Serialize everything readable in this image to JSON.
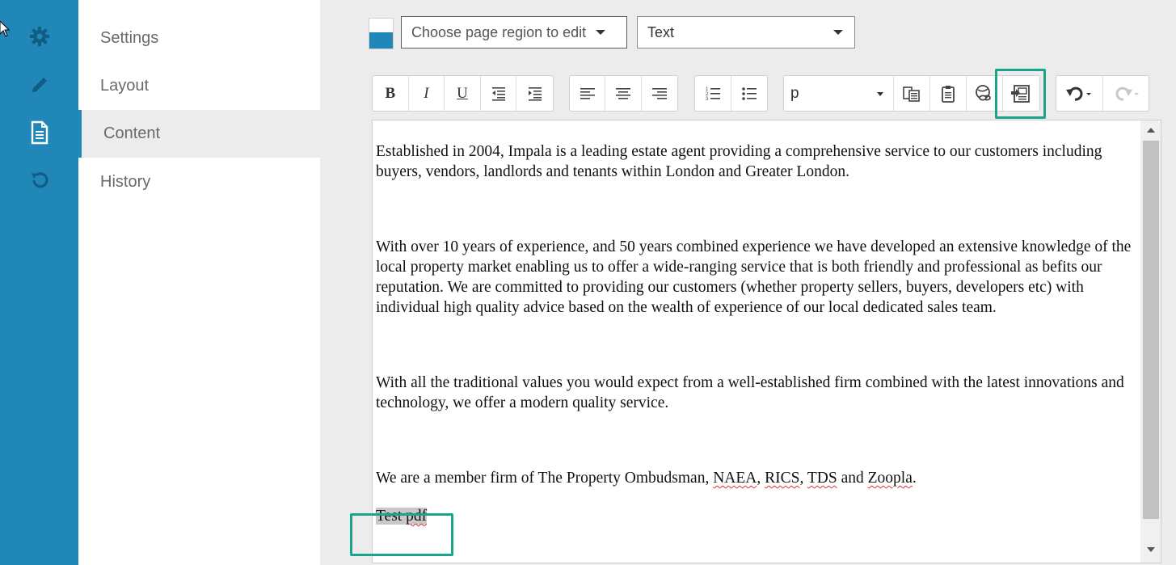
{
  "rail": {
    "icons": [
      "gear-icon",
      "pencil-icon",
      "document-icon",
      "history-icon"
    ],
    "active_index": 2
  },
  "nav": {
    "items": [
      {
        "label": "Settings"
      },
      {
        "label": "Layout"
      },
      {
        "label": "Content"
      },
      {
        "label": "History"
      }
    ],
    "active": "Content"
  },
  "top": {
    "region_select": "Choose page region to edit",
    "type_select": "Text"
  },
  "toolbar": {
    "bold": "B",
    "italic": "I",
    "underline": "U",
    "format_value": "p",
    "highlighted_button": "insert-document-icon"
  },
  "editor": {
    "paragraphs": [
      "Established in 2004, Impala is a leading estate agent providing a comprehensive service to our customers including buyers, vendors, landlords and tenants within London and Greater London.",
      "With over 10 years of experience, and 50 years combined experience we have developed an extensive knowledge of the local property market enabling us to offer a wide-ranging service that is both friendly and professional as befits our reputation. We are committed to providing our customers (whether property sellers, buyers, developers etc) with individual high quality advice based on the wealth of experience of our local dedicated sales team.",
      "With all the traditional values you would expect from a well-established firm combined with the latest innovations and technology, we offer a modern quality service."
    ],
    "member_line": {
      "prefix": "We are a member firm of The Property Ombudsman, ",
      "naea": "NAEA",
      "sep1": ", ",
      "rics": "RICS",
      "sep2": ", ",
      "tds": "TDS",
      "and": " and ",
      "zoopla": "Zoopla",
      "end": "."
    },
    "selected_text_1": "Test ",
    "selected_text_2": "pdf"
  },
  "colors": {
    "accent": "#2187b8",
    "highlight": "#1aa58a"
  }
}
